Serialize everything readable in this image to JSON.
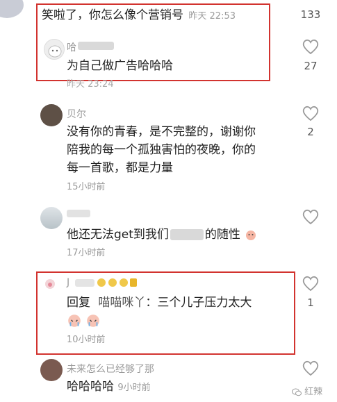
{
  "comments": [
    {
      "text_before_time": "笑啦了，你怎么像个营销号",
      "time": "昨天 22:53",
      "likes": "133"
    },
    {
      "username": "哈",
      "text": "为自己做广告哈哈哈",
      "time": "昨天 23:24",
      "likes": "27"
    },
    {
      "username": "贝尔",
      "text_lines": [
        "没有你的青春，是不完整的，谢谢你",
        "陪我的每一个孤独害怕的夜晚，你的",
        "每一首歌，都是力量"
      ],
      "time": "15小时前",
      "likes": "2"
    },
    {
      "text_a": "他还无法get到我们",
      "text_b": "的随性",
      "time": "17小时前"
    },
    {
      "username": "J",
      "reply_prefix": "回复",
      "reply_target": "喵喵咪丫",
      "reply_text": "：三个儿子压力太大",
      "time": "10小时前",
      "likes": "1"
    },
    {
      "username": "未来怎么已经够了那",
      "text": "哈哈哈哈",
      "time": "9小时前"
    }
  ],
  "watermark": "红辣",
  "colors": {
    "highlight_border": "#d2332f",
    "meta_text": "#9a9a9a",
    "reply_name": "#555555"
  }
}
